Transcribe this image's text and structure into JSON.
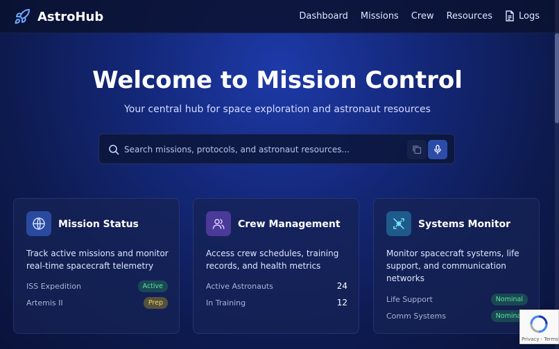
{
  "brand": {
    "name": "AstroHub"
  },
  "nav": {
    "items": [
      "Dashboard",
      "Missions",
      "Crew",
      "Resources",
      "Logs"
    ]
  },
  "hero": {
    "title": "Welcome to Mission Control",
    "subtitle": "Your central hub for space exploration and astronaut resources"
  },
  "search": {
    "placeholder": "Search missions, protocols, and astronaut resources...",
    "value": ""
  },
  "cards": [
    {
      "title": "Mission Status",
      "description": "Track active missions and monitor real-time spacecraft telemetry",
      "icon": "globe-icon",
      "stats": [
        {
          "label": "ISS Expedition",
          "value": "Active",
          "kind": "badge"
        },
        {
          "label": "Artemis II",
          "value": "Prep",
          "kind": "badge"
        }
      ]
    },
    {
      "title": "Crew Management",
      "description": "Access crew schedules, training records, and health metrics",
      "icon": "users-icon",
      "stats": [
        {
          "label": "Active Astronauts",
          "value": "24",
          "kind": "number"
        },
        {
          "label": "In Training",
          "value": "12",
          "kind": "number"
        }
      ]
    },
    {
      "title": "Systems Monitor",
      "description": "Monitor spacecraft systems, life support, and communication networks",
      "icon": "satellite-icon",
      "stats": [
        {
          "label": "Life Support",
          "value": "Nominal",
          "kind": "badge"
        },
        {
          "label": "Comm Systems",
          "value": "Nominal",
          "kind": "badge"
        }
      ]
    }
  ],
  "recaptcha": {
    "text": "Privacy - Terms"
  },
  "colors": {
    "accent": "#2c4ca8",
    "success": "#63e19e",
    "warning": "#f0d060"
  }
}
